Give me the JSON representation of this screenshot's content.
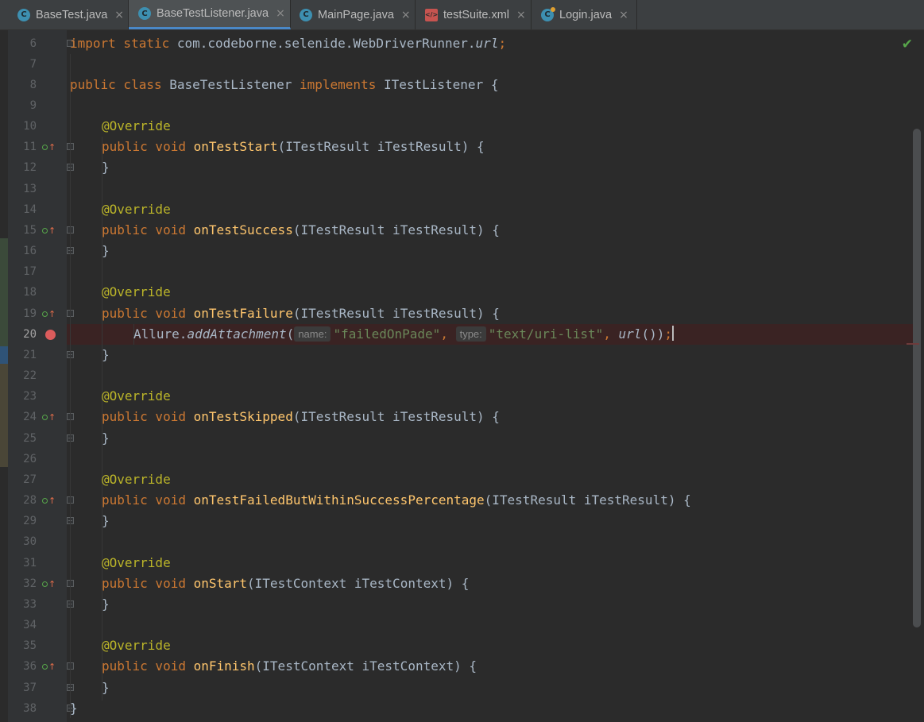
{
  "tabs": [
    {
      "label": "BaseTest.java",
      "icon": "java-class-icon",
      "active": false
    },
    {
      "label": "BaseTestListener.java",
      "icon": "java-class-icon",
      "active": true
    },
    {
      "label": "MainPage.java",
      "icon": "java-class-icon",
      "active": false
    },
    {
      "label": "testSuite.xml",
      "icon": "xml-file-icon",
      "active": false
    },
    {
      "label": "Login.java",
      "icon": "java-class-modified-icon",
      "active": false
    }
  ],
  "close_glyph": "×",
  "lines": {
    "n6": "6",
    "n7": "7",
    "n8": "8",
    "n9": "9",
    "n10": "10",
    "n11": "11",
    "n12": "12",
    "n13": "13",
    "n14": "14",
    "n15": "15",
    "n16": "16",
    "n17": "17",
    "n18": "18",
    "n19": "19",
    "n20": "20",
    "n21": "21",
    "n22": "22",
    "n23": "23",
    "n24": "24",
    "n25": "25",
    "n26": "26",
    "n27": "27",
    "n28": "28",
    "n29": "29",
    "n30": "30",
    "n31": "31",
    "n32": "32",
    "n33": "33",
    "n34": "34",
    "n35": "35",
    "n36": "36",
    "n37": "37",
    "n38": "38"
  },
  "code": {
    "import_kw": "import static ",
    "import_path": "com.codeborne.selenide.WebDriverRunner.",
    "import_member": "url",
    "semicolon": ";",
    "class_kw": "public class ",
    "class_name": "BaseTestListener ",
    "implements_kw": "implements ",
    "iface": "ITestListener {",
    "annotation": "@Override",
    "pv": "public void ",
    "close_brace": "}",
    "m11_name": "onTestStart",
    "m11_params": "(ITestResult iTestResult) {",
    "m15_name": "onTestSuccess",
    "m15_params": "(ITestResult iTestResult) {",
    "m19_name": "onTestFailure",
    "m19_params": "(ITestResult iTestResult) {",
    "l20_obj": "Allure.",
    "l20_method": "addAttachment",
    "l20_open": "(",
    "l20_hint1": "name:",
    "l20_str1": "\"failedOnPade\"",
    "l20_comma": ", ",
    "l20_hint2": "type:",
    "l20_str2": "\"text/uri-list\"",
    "l20_url": "url",
    "l20_end": "())",
    "m24_name": "onTestSkipped",
    "m24_params": "(ITestResult iTestResult) {",
    "m28_name": "onTestFailedButWithinSuccessPercentage",
    "m28_params": "(ITestResult iTestResult) {",
    "m32_name": "onStart",
    "m32_params": "(ITestContext iTestContext) {",
    "m36_name": "onFinish",
    "m36_params": "(ITestContext iTestContext) {"
  },
  "status": {
    "inspection_icon": "checkmark-icon",
    "glyph": "✔"
  },
  "colors": {
    "keyword": "#cc7832",
    "annotation": "#bbb529",
    "method": "#ffc66d",
    "string": "#6a8759",
    "text": "#a9b7c6",
    "breakpoint": "#db5c5c"
  }
}
